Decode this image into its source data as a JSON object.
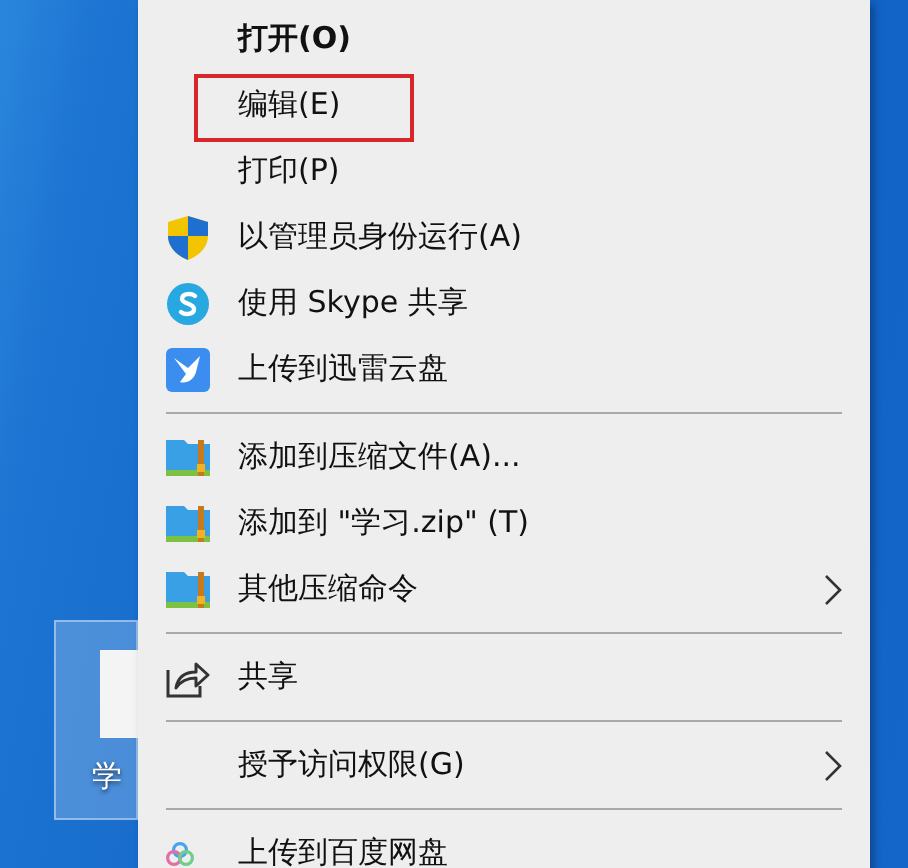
{
  "desktop_icon": {
    "label": "学",
    "selected": true
  },
  "context_menu": {
    "entries": [
      {
        "kind": "plain",
        "label": "打开(O)",
        "default": true,
        "submenu": false,
        "highlighted": false
      },
      {
        "kind": "plain",
        "label": "编辑(E)",
        "default": false,
        "submenu": false,
        "highlighted": true
      },
      {
        "kind": "plain",
        "label": "打印(P)",
        "default": false,
        "submenu": false,
        "highlighted": false
      },
      {
        "kind": "shield",
        "label": "以管理员身份运行(A)",
        "default": false,
        "submenu": false,
        "highlighted": false
      },
      {
        "kind": "skype",
        "label": "使用 Skype 共享",
        "default": false,
        "submenu": false,
        "highlighted": false
      },
      {
        "kind": "bird",
        "label": "上传到迅雷云盘",
        "default": false,
        "submenu": false,
        "highlighted": false
      },
      {
        "kind": "separator"
      },
      {
        "kind": "archive",
        "label": "添加到压缩文件(A)...",
        "default": false,
        "submenu": false,
        "highlighted": false
      },
      {
        "kind": "archive",
        "label": "添加到 \"学习.zip\" (T)",
        "default": false,
        "submenu": false,
        "highlighted": false
      },
      {
        "kind": "archive",
        "label": "其他压缩命令",
        "default": false,
        "submenu": true,
        "highlighted": false
      },
      {
        "kind": "separator"
      },
      {
        "kind": "share",
        "label": "共享",
        "default": false,
        "submenu": false,
        "highlighted": false
      },
      {
        "kind": "separator"
      },
      {
        "kind": "plain",
        "label": "授予访问权限(G)",
        "default": false,
        "submenu": true,
        "highlighted": false
      },
      {
        "kind": "separator"
      },
      {
        "kind": "cloud",
        "label": "上传到百度网盘",
        "default": false,
        "submenu": false,
        "highlighted": false
      }
    ]
  }
}
